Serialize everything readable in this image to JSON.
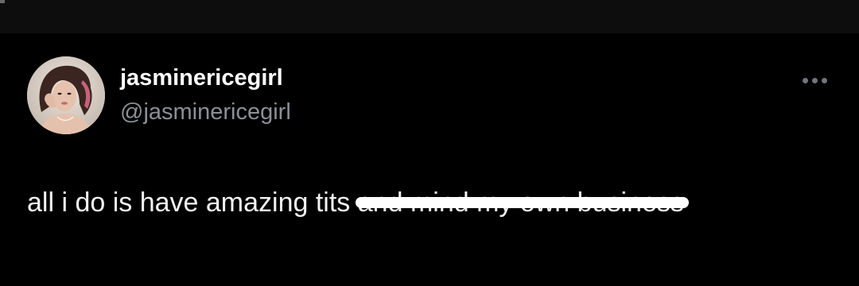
{
  "post": {
    "author": {
      "display_name": "jasminericegirl",
      "handle": "@jasminericegirl",
      "avatar_icon": "profile-photo"
    },
    "more_icon": "more-horizontal-icon",
    "text_visible": "all i do is have amazing tits",
    "text_scribbled": "and mind my own business"
  },
  "colors": {
    "background": "#000000",
    "top_bar": "#0d0d0d",
    "name": "#ffffff",
    "handle": "#8b9095",
    "body_text": "#f2f2f2",
    "scribble": "#ffffff"
  }
}
